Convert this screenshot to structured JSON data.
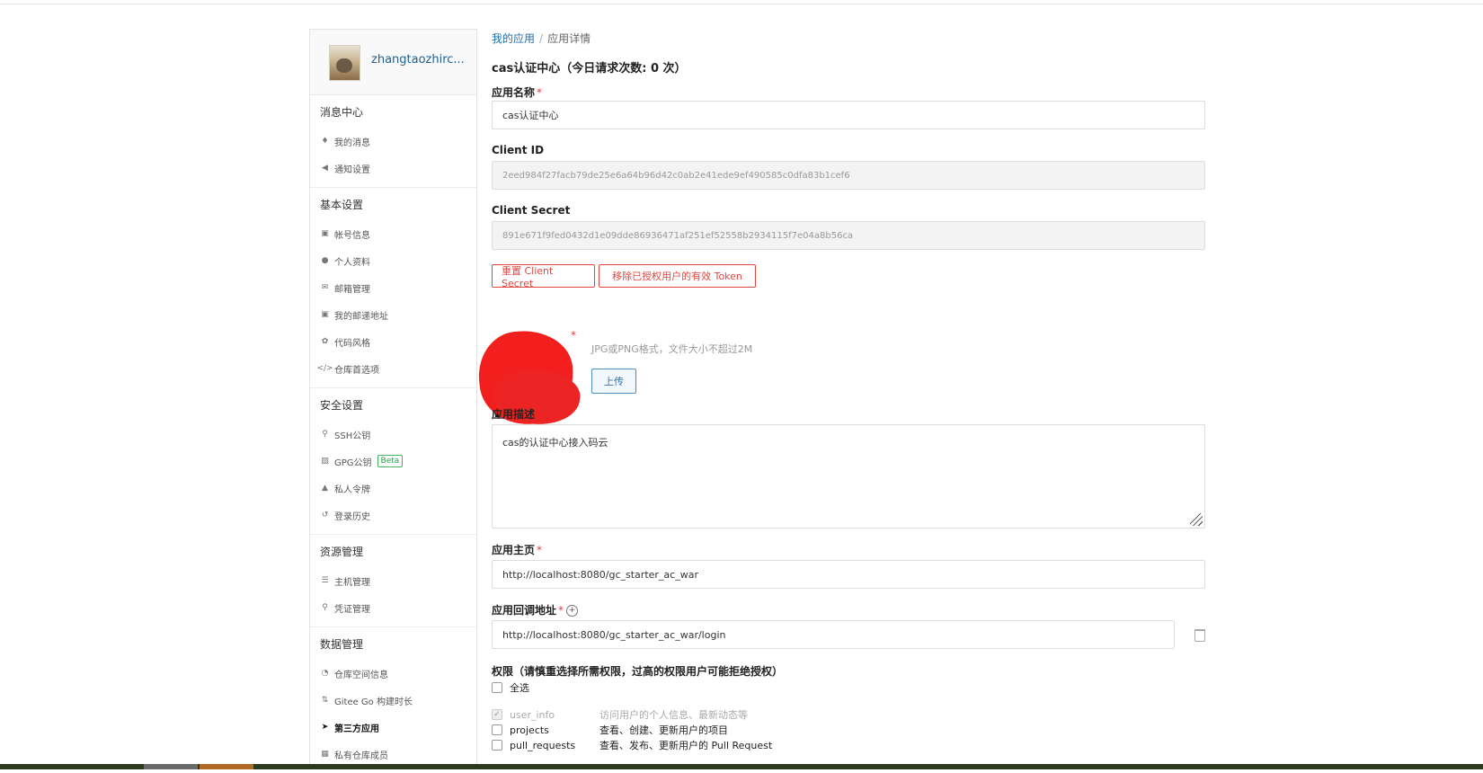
{
  "user": {
    "name": "zhangtaozhirc..."
  },
  "sidebar": [
    {
      "title": "消息中心",
      "items": [
        {
          "label": "我的消息",
          "icon": "bell-icon"
        },
        {
          "label": "通知设置",
          "icon": "speaker-icon"
        }
      ]
    },
    {
      "title": "基本设置",
      "items": [
        {
          "label": "帐号信息",
          "icon": "id-card-icon"
        },
        {
          "label": "个人资料",
          "icon": "user-icon"
        },
        {
          "label": "邮箱管理",
          "icon": "mail-icon"
        },
        {
          "label": "我的邮递地址",
          "icon": "address-card-icon"
        },
        {
          "label": "代码风格",
          "icon": "palette-icon"
        },
        {
          "label": "仓库首选项",
          "icon": "code-icon"
        }
      ]
    },
    {
      "title": "安全设置",
      "items": [
        {
          "label": "SSH公钥",
          "icon": "key-icon"
        },
        {
          "label": "GPG公钥",
          "icon": "lock-icon",
          "badge": "Beta"
        },
        {
          "label": "私人令牌",
          "icon": "token-icon"
        },
        {
          "label": "登录历史",
          "icon": "history-icon"
        }
      ]
    },
    {
      "title": "资源管理",
      "items": [
        {
          "label": "主机管理",
          "icon": "server-icon"
        },
        {
          "label": "凭证管理",
          "icon": "credential-key-icon"
        }
      ]
    },
    {
      "title": "数据管理",
      "items": [
        {
          "label": "仓库空间信息",
          "icon": "pie-chart-icon"
        },
        {
          "label": "Gitee Go 构建时长",
          "icon": "pipeline-icon"
        },
        {
          "label": "第三方应用",
          "icon": "rocket-icon",
          "active": true
        },
        {
          "label": "私有仓库成员",
          "icon": "members-icon"
        }
      ]
    }
  ],
  "breadcrumb": {
    "home": "我的应用",
    "sep": "/",
    "current": "应用详情"
  },
  "page_title": "cas认证中心（今日请求次数: 0 次）",
  "form": {
    "app_name_label": "应用名称",
    "required_mark": "*",
    "app_name_value": "cas认证中心",
    "client_id_label": "Client ID",
    "client_id_value": "2eed984f27facb79de25e6a64b96d42c0ab2e41ede9ef490585c0dfa83b1cef6",
    "client_secret_label": "Client Secret",
    "client_secret_value": "891e671f9fed0432d1e09dde86936471af251ef52558b2934115f7e04a8b56ca",
    "reset_secret_button": "重置 Client Secret",
    "revoke_token_button": "移除已授权用户的有效 Token",
    "logo_hint": "JPG或PNG格式，文件大小不超过2M",
    "upload_button": "上传",
    "description_label": "应用描述",
    "description_value": "cas的认证中心接入码云",
    "homepage_label": "应用主页",
    "homepage_value": "http://localhost:8080/gc_starter_ac_war",
    "callback_label": "应用回调地址",
    "callback_value": "http://localhost:8080/gc_starter_ac_war/login",
    "permissions_label": "权限（请慎重选择所需权限，过高的权限用户可能拒绝授权）",
    "select_all": "全选",
    "permissions": [
      {
        "name": "user_info",
        "desc": "访问用户的个人信息、最新动态等",
        "checked": true,
        "disabled": true
      },
      {
        "name": "projects",
        "desc": "查看、创建、更新用户的项目",
        "checked": false,
        "disabled": false
      },
      {
        "name": "pull_requests",
        "desc": "查看、发布、更新用户的 Pull Request",
        "checked": false,
        "disabled": false
      }
    ]
  }
}
